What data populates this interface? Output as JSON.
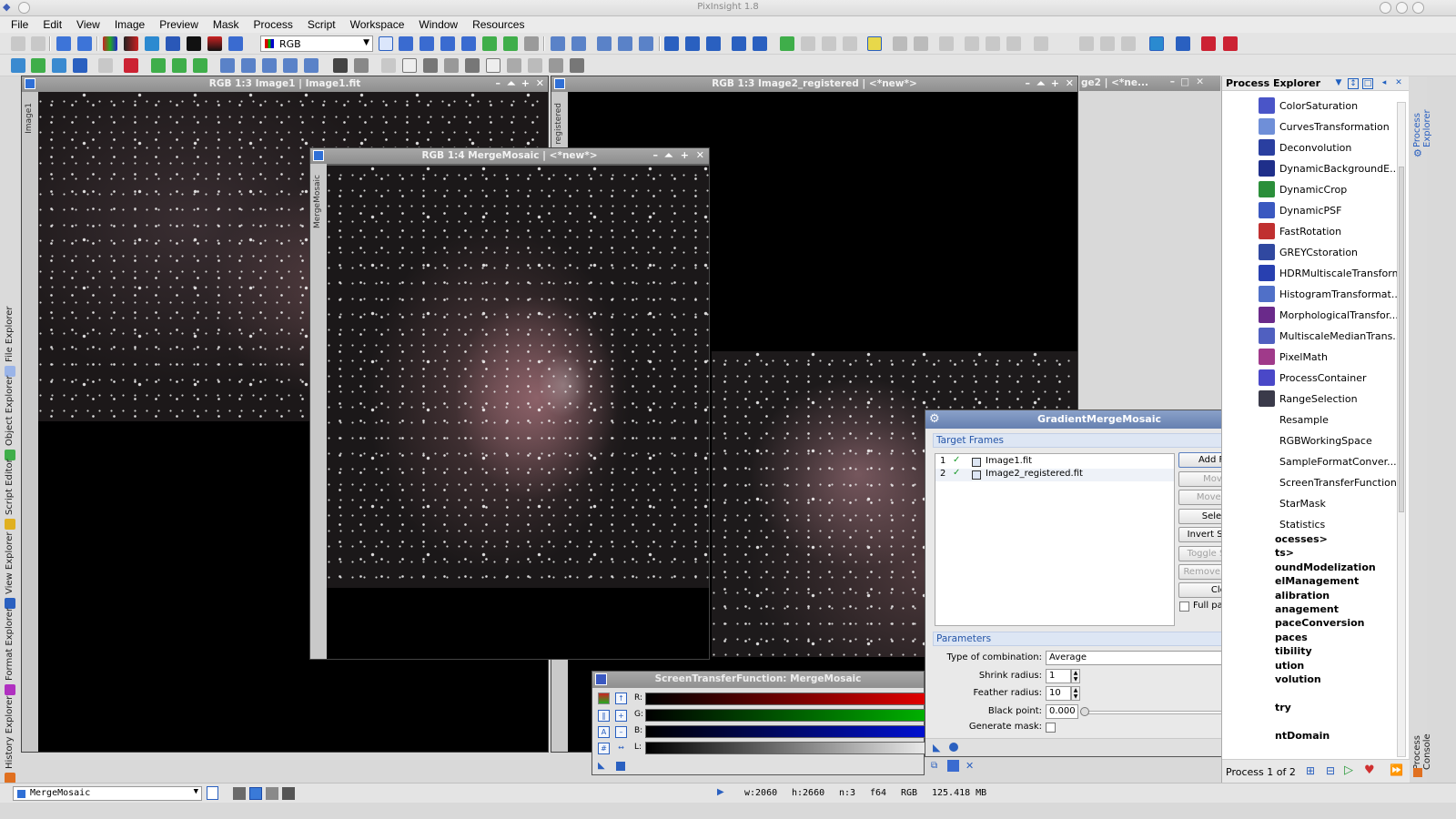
{
  "app": {
    "title": "PixInsight 1.8"
  },
  "menu": [
    "File",
    "Edit",
    "View",
    "Image",
    "Preview",
    "Mask",
    "Process",
    "Script",
    "Workspace",
    "Window",
    "Resources"
  ],
  "toolbar": {
    "color_space_value": "RGB"
  },
  "left_dock": [
    "File Explorer",
    "Object Explorer",
    "Script Editor",
    "View Explorer",
    "Format Explorer",
    "History Explorer"
  ],
  "windows": {
    "image1": {
      "title": "RGB 1:3 Image1 | Image1.fit",
      "side_label": "Image1"
    },
    "image2": {
      "title": "RGB 1:3 Image2_registered | <*new*>",
      "title_overflow": "ge2 | <*ne...",
      "side_label": "registered"
    },
    "merge": {
      "title": "RGB 1:4 MergeMosaic | <*new*>",
      "side_label": "MergeMosaic"
    }
  },
  "process_explorer": {
    "title": "Process Explorer",
    "items": [
      {
        "label": "ColorSaturation",
        "icon": "color-saturation-icon",
        "color": "#4a55c8"
      },
      {
        "label": "CurvesTransformation",
        "icon": "curves-icon",
        "color": "#6f8fd8"
      },
      {
        "label": "Deconvolution",
        "icon": "deconvolution-icon",
        "color": "#2a3fa0"
      },
      {
        "label": "DynamicBackgroundE...",
        "icon": "dbe-icon",
        "color": "#1f2f8a"
      },
      {
        "label": "DynamicCrop",
        "icon": "crop-icon",
        "color": "#2b8f3a"
      },
      {
        "label": "DynamicPSF",
        "icon": "psf-icon",
        "color": "#3a58c0"
      },
      {
        "label": "FastRotation",
        "icon": "rotation-icon",
        "color": "#c03030"
      },
      {
        "label": "GREYCstoration",
        "icon": "greyc-icon",
        "color": "#3048a0"
      },
      {
        "label": "HDRMultiscaleTransform",
        "icon": "hdr-icon",
        "color": "#2840b0"
      },
      {
        "label": "HistogramTransformat...",
        "icon": "histogram-icon",
        "color": "#5070c8"
      },
      {
        "label": "MorphologicalTransfor...",
        "icon": "morphological-icon",
        "color": "#6a2a8a"
      },
      {
        "label": "MultiscaleMedianTrans...",
        "icon": "median-icon",
        "color": "#5060c0"
      },
      {
        "label": "PixelMath",
        "icon": "pixelmath-icon",
        "color": "#a03a8a"
      },
      {
        "label": "ProcessContainer",
        "icon": "container-icon",
        "color": "#4a48c8"
      },
      {
        "label": "RangeSelection",
        "icon": "range-icon",
        "color": "#3a3a4a"
      },
      {
        "label": "Resample",
        "icon": "resample-icon",
        "color": "#ffffff"
      },
      {
        "label": "RGBWorkingSpace",
        "icon": "rgb-ws-icon",
        "color": "#ffffff"
      },
      {
        "label": "SampleFormatConver...",
        "icon": "sample-format-icon",
        "color": "#ffffff"
      },
      {
        "label": "ScreenTransferFunction",
        "icon": "stf-icon",
        "color": "#ffffff"
      },
      {
        "label": "StarMask",
        "icon": "starmask-icon",
        "color": "#ffffff"
      },
      {
        "label": "Statistics",
        "icon": "statistics-icon",
        "color": "#ffffff"
      }
    ],
    "categories": [
      "ocesses>",
      "ts>",
      "oundModelization",
      "elManagement",
      "alibration",
      "anagement",
      "paceConversion",
      "paces",
      "tibility",
      "ution",
      "volution",
      "",
      "try",
      "",
      "ntDomain"
    ],
    "footer": "Process 1 of 2"
  },
  "right_dock": [
    "Process Explorer",
    "Process Console"
  ],
  "gmm": {
    "title": "GradientMergeMosaic",
    "target_frames_label": "Target Frames",
    "files": [
      {
        "index": "1",
        "name": "Image1.fit"
      },
      {
        "index": "2",
        "name": "Image2_registered.fit"
      }
    ],
    "buttons": {
      "add_files": "Add Files...",
      "move_up": "Move Up",
      "move_down": "Move Down",
      "select_all": "Select All",
      "invert_selection": "Invert Selection",
      "toggle_selected": "Toggle Selected",
      "remove_selected": "Remove Selected",
      "clear": "Clear"
    },
    "full_paths_label": "Full paths",
    "parameters_label": "Parameters",
    "type_of_combination_label": "Type of combination:",
    "type_of_combination_value": "Average",
    "shrink_radius_label": "Shrink radius:",
    "shrink_radius_value": "1",
    "feather_radius_label": "Feather radius:",
    "feather_radius_value": "10",
    "black_point_label": "Black point:",
    "black_point_value": "0.000",
    "generate_mask_label": "Generate mask:"
  },
  "stf": {
    "title": "ScreenTransferFunction: MergeMosaic",
    "channels": [
      "R:",
      "G:",
      "B:",
      "L:"
    ]
  },
  "statusbar": {
    "view": "MergeMosaic",
    "width": "w:2060",
    "height": "h:2660",
    "channels": "n:3",
    "format": "f64",
    "color_space": "RGB",
    "memory": "125.418 MB"
  }
}
